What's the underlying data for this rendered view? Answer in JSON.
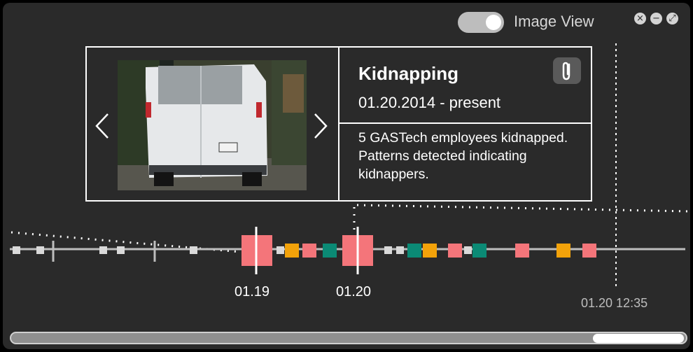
{
  "window": {
    "toggle_label": "Image View",
    "toggle_on": true,
    "buttons": [
      "close-icon",
      "minimize-icon",
      "expand-icon"
    ]
  },
  "event": {
    "title": "Kidnapping",
    "date_range": "01.20.2014 - present",
    "description": "5 GASTech employees kidnapped. Patterns detected indicating kidnappers.",
    "photo": "white-van-rear-view",
    "attachment_icon": "paperclip-icon"
  },
  "timeline": {
    "labels": [
      "01.19",
      "01.20"
    ],
    "current_time": "01.20 12:35",
    "colors": {
      "pink": "#f4757a",
      "orange": "#f2a20a",
      "teal": "#0b8a75",
      "gray": "#d9d9d9"
    }
  },
  "scrollbar": {
    "thumb_position": 0.87
  }
}
